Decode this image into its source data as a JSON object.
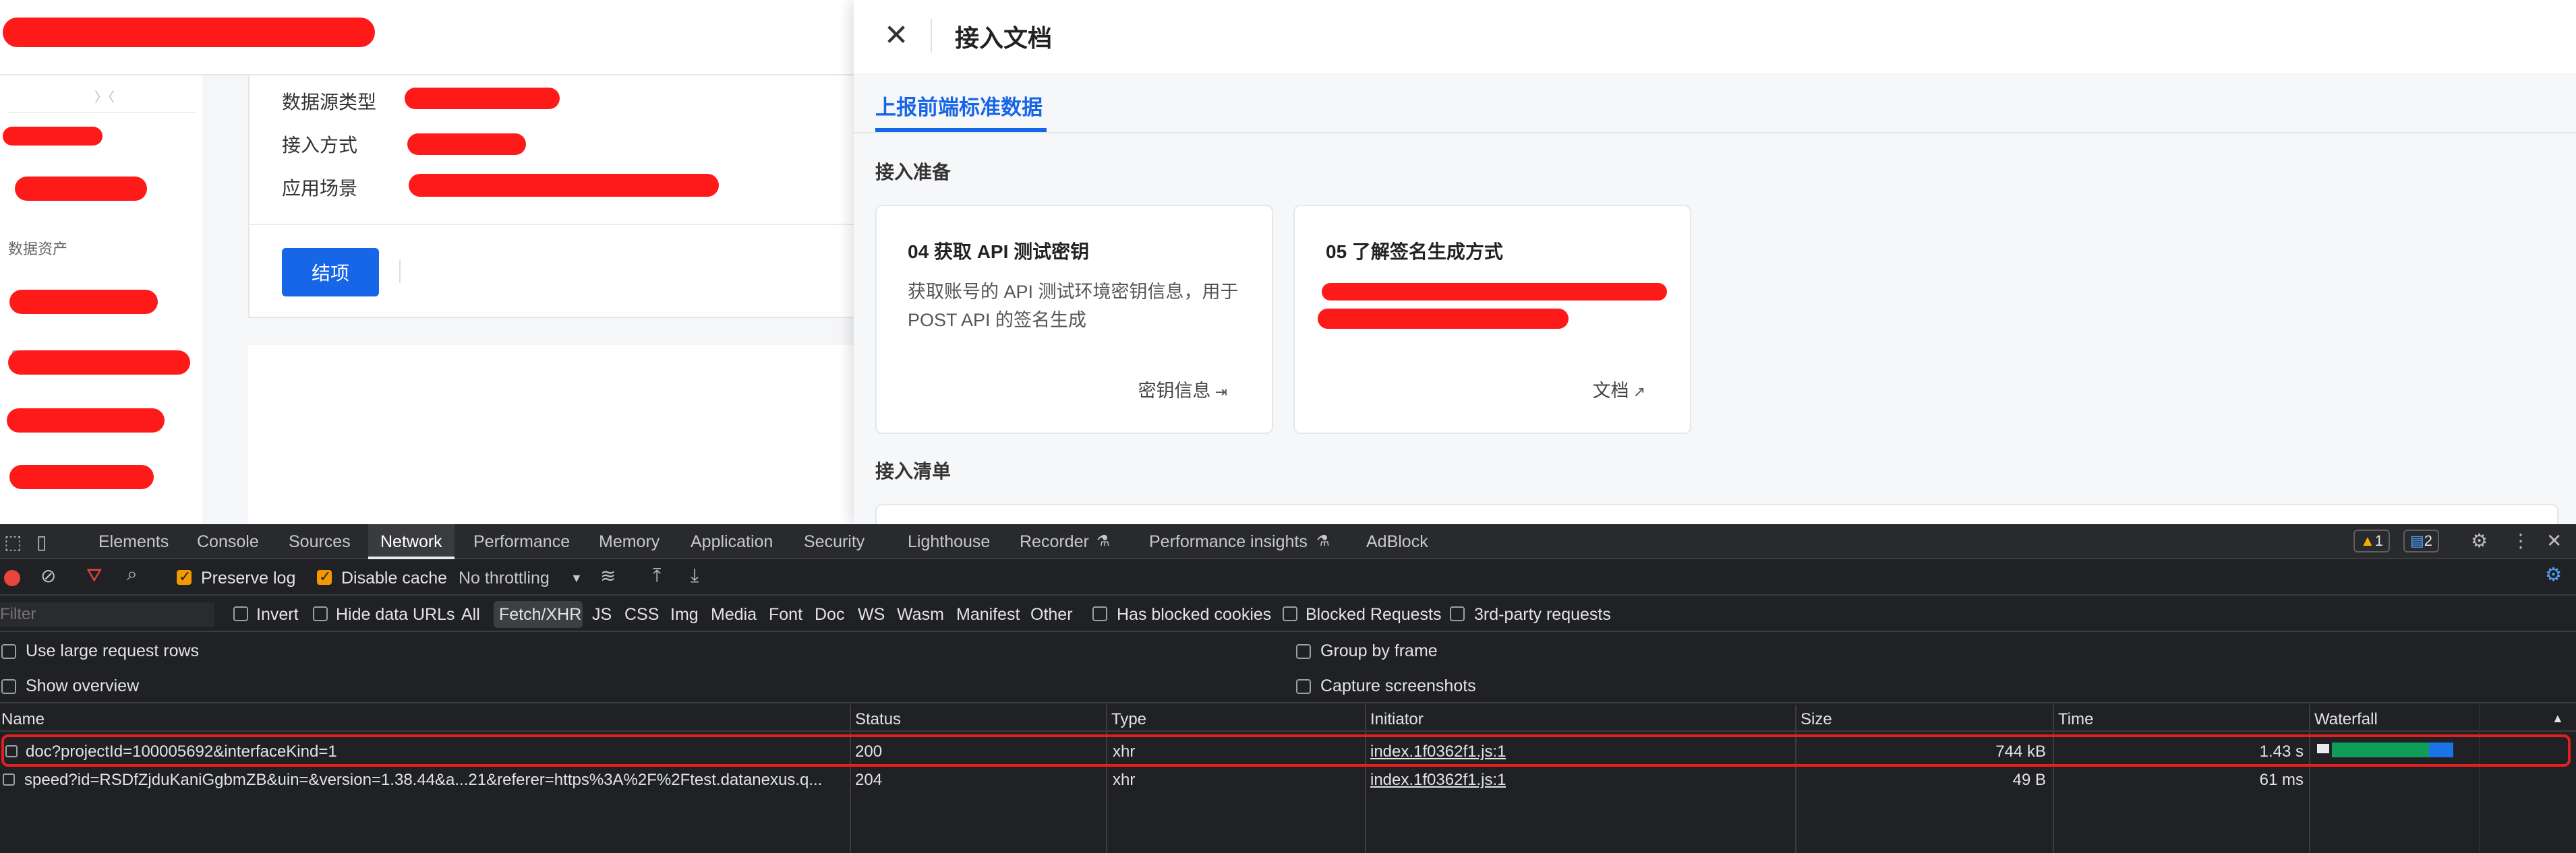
{
  "page": {
    "info_labels": [
      "数据源类型",
      "接入方式",
      "应用场景"
    ],
    "sidebar_section": "数据资产",
    "finish_button": "结项"
  },
  "drawer": {
    "title": "接入文档",
    "tab": "上报前端标准数据",
    "prep_title": "接入准备",
    "cards": [
      {
        "title": "04 获取 API 测试密钥",
        "desc": "获取账号的 API 测试环境密钥信息，用于 POST API 的签名生成",
        "link": "密钥信息"
      },
      {
        "title": "05 了解签名生成方式",
        "desc": "",
        "link": "文档"
      }
    ],
    "list_title": "接入清单"
  },
  "devtools": {
    "tabs": [
      "Elements",
      "Console",
      "Sources",
      "Network",
      "Performance",
      "Memory",
      "Application",
      "Security",
      "Lighthouse",
      "Recorder",
      "Performance insights",
      "AdBlock"
    ],
    "warning_count": "1",
    "message_count": "2",
    "toolbar": {
      "preserve_log": "Preserve log",
      "disable_cache": "Disable cache",
      "throttling": "No throttling"
    },
    "filter": {
      "placeholder": "Filter",
      "invert": "Invert",
      "hide_data_urls": "Hide data URLs",
      "types": [
        "All",
        "Fetch/XHR",
        "JS",
        "CSS",
        "Img",
        "Media",
        "Font",
        "Doc",
        "WS",
        "Wasm",
        "Manifest",
        "Other"
      ],
      "has_blocked_cookies": "Has blocked cookies",
      "blocked_requests": "Blocked Requests",
      "third_party": "3rd-party requests"
    },
    "options": {
      "large_rows": "Use large request rows",
      "show_overview": "Show overview",
      "group_by_frame": "Group by frame",
      "capture_screenshots": "Capture screenshots"
    },
    "columns": [
      "Name",
      "Status",
      "Type",
      "Initiator",
      "Size",
      "Time",
      "Waterfall"
    ],
    "rows": [
      {
        "name": "doc?projectId=100005692&interfaceKind=1",
        "status": "200",
        "type": "xhr",
        "initiator": "index.1f0362f1.js:1",
        "size": "744 kB",
        "time": "1.43 s"
      },
      {
        "name": "speed?id=RSDfZjduKaniGgbmZB&uin=&version=1.38.44&a...21&referer=https%3A%2F%2Ftest.datanexus.q...",
        "status": "204",
        "type": "xhr",
        "initiator": "index.1f0362f1.js:1",
        "size": "49 B",
        "time": "61 ms"
      }
    ]
  }
}
